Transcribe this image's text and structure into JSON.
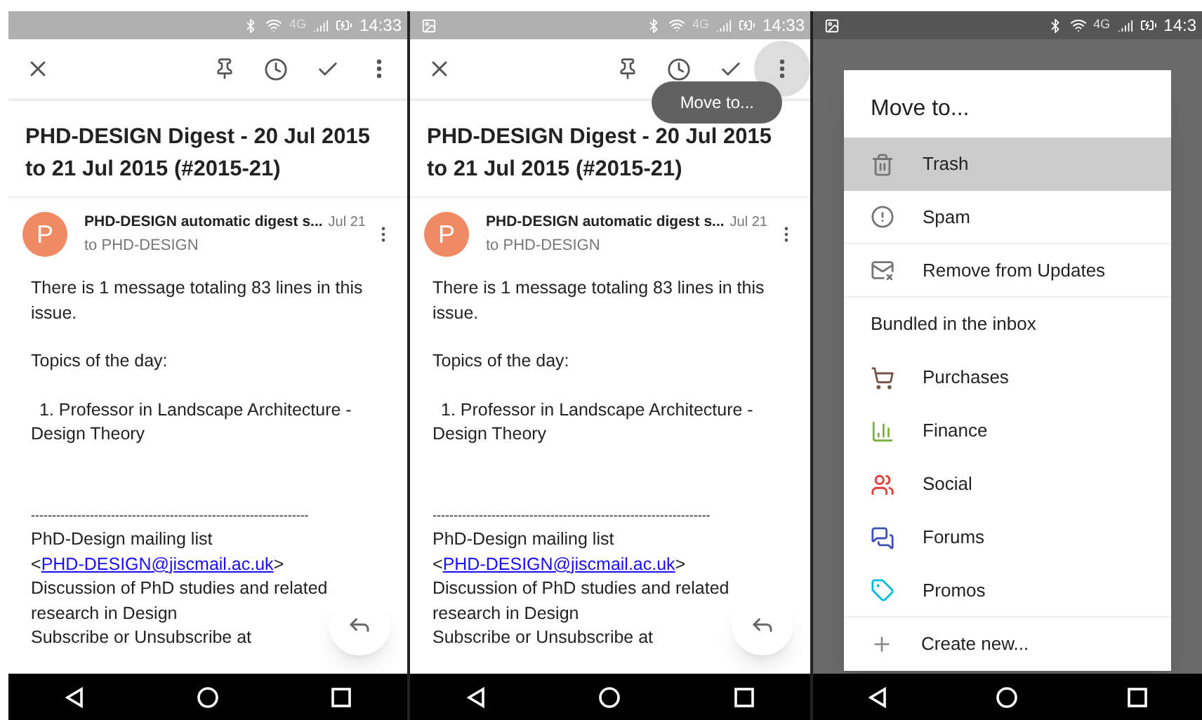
{
  "screens": [
    {
      "kind": "email",
      "status_bar": {
        "network": "4G",
        "time": "14:33",
        "image_notification": false
      },
      "more_pressed": false,
      "subject": "PHD-DESIGN Digest - 20 Jul 2015 to 21 Jul 2015 (#2015-21)",
      "avatar_letter": "P",
      "sender": "PHD-DESIGN automatic digest s...",
      "date": "Jul 21",
      "recipient": "to PHD-DESIGN",
      "body": {
        "intro": "There is 1 message totaling 83 lines in this issue.",
        "topics_heading": "Topics of the day:",
        "topic": "1. Professor in Landscape Architecture - Design Theory",
        "separator": "------------------------------------------------------------------",
        "list_prefix": "PhD-Design mailing list  <",
        "list_link": "PHD-DESIGN@jiscmail.ac.uk",
        "list_suffix": ">",
        "discussion": "Discussion of PhD studies and related research in Design",
        "subscribe": "Subscribe or Unsubscribe at"
      }
    },
    {
      "kind": "email",
      "status_bar": {
        "network": "4G",
        "time": "14:33",
        "image_notification": true
      },
      "more_pressed": true,
      "tooltip": "Move to...",
      "subject": "PHD-DESIGN Digest - 20 Jul 2015 to 21 Jul 2015 (#2015-21)",
      "avatar_letter": "P",
      "sender": "PHD-DESIGN automatic digest s...",
      "date": "Jul 21",
      "recipient": "to PHD-DESIGN",
      "body": {
        "intro": "There is 1 message totaling 83 lines in this issue.",
        "topics_heading": "Topics of the day:",
        "topic": "1. Professor in Landscape Architecture - Design Theory",
        "separator": "------------------------------------------------------------------",
        "list_prefix": "PhD-Design mailing list  <",
        "list_link": "PHD-DESIGN@jiscmail.ac.uk",
        "list_suffix": ">",
        "discussion": "Discussion of PhD studies and related research in Design",
        "subscribe": "Subscribe or Unsubscribe at"
      }
    },
    {
      "kind": "dialog",
      "status_bar": {
        "network": "4G",
        "time": "14:3",
        "image_notification": true
      },
      "dialog": {
        "title": "Move to...",
        "items": [
          {
            "kind": "item",
            "label": "Trash",
            "selected": true,
            "color": "#757575",
            "divider": false
          },
          {
            "kind": "item",
            "label": "Spam",
            "selected": false,
            "color": "#757575",
            "divider": true
          },
          {
            "kind": "item",
            "label": "Remove from Updates",
            "selected": false,
            "color": "#757575",
            "divider": true
          },
          {
            "kind": "header",
            "label": "Bundled in the inbox"
          },
          {
            "kind": "item",
            "label": "Purchases",
            "selected": false,
            "color": "#795548",
            "divider": false
          },
          {
            "kind": "item",
            "label": "Finance",
            "selected": false,
            "color": "#7cb342",
            "divider": false
          },
          {
            "kind": "item",
            "label": "Social",
            "selected": false,
            "color": "#e53935",
            "divider": false
          },
          {
            "kind": "item",
            "label": "Forums",
            "selected": false,
            "color": "#3f51b5",
            "divider": false
          },
          {
            "kind": "item",
            "label": "Promos",
            "selected": false,
            "color": "#00bcd4",
            "divider": true
          },
          {
            "kind": "create",
            "label": "Create new..."
          }
        ]
      }
    }
  ]
}
